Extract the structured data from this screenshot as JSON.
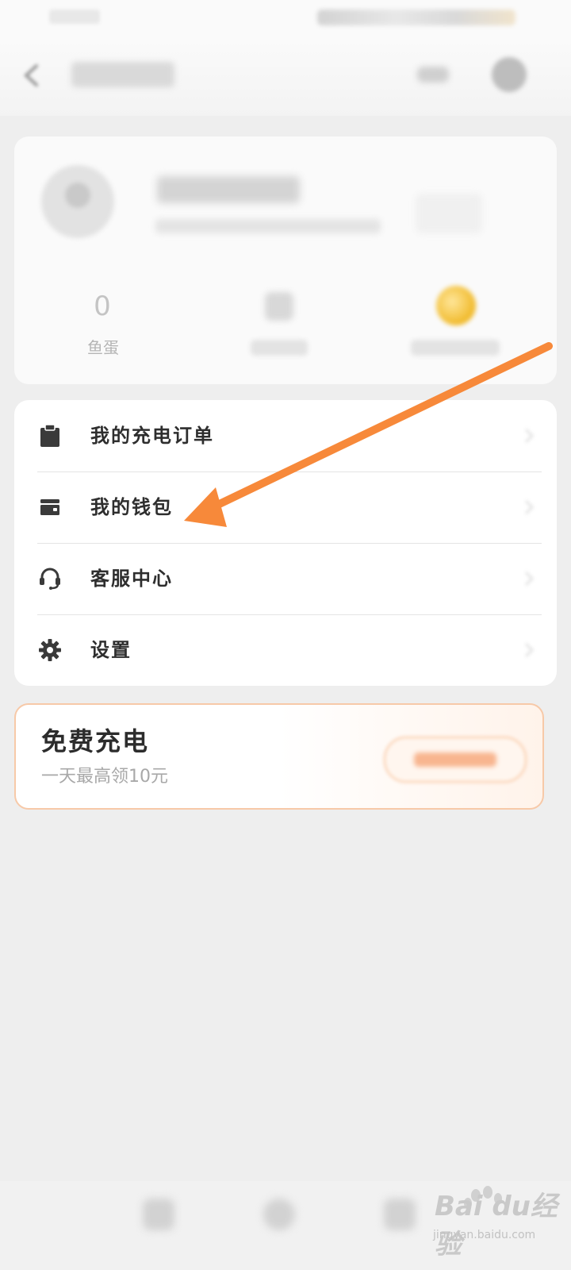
{
  "stats": {
    "items": [
      {
        "value": "0",
        "label": "鱼蛋"
      }
    ]
  },
  "menu": {
    "items": [
      {
        "label": "我的充电订单",
        "icon": "clipboard-icon"
      },
      {
        "label": "我的钱包",
        "icon": "wallet-icon"
      },
      {
        "label": "客服中心",
        "icon": "headset-icon"
      },
      {
        "label": "设置",
        "icon": "gear-icon"
      }
    ]
  },
  "promo": {
    "title": "免费充电",
    "subtitle": "一天最高领10元"
  },
  "watermark": {
    "text": "Bai du经验",
    "sub": "jingyan.baidu.com"
  },
  "colors": {
    "accent_arrow": "#f7893a",
    "promo_border": "#f7c9a8"
  }
}
